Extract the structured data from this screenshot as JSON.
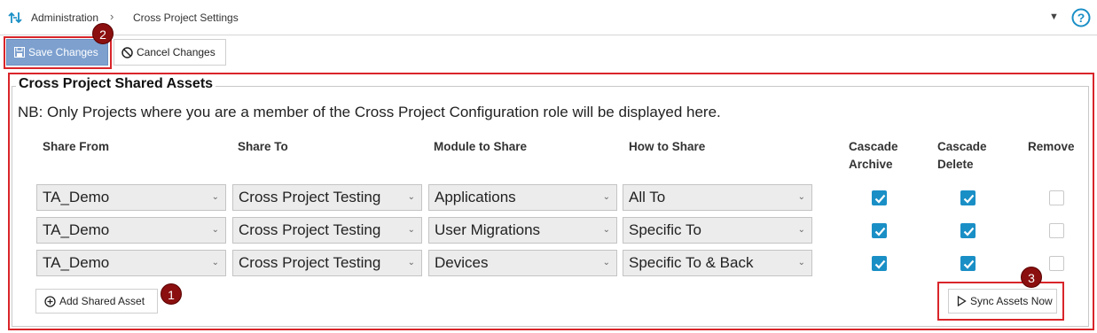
{
  "breadcrumb": {
    "root": "Administration",
    "current": "Cross Project Settings"
  },
  "toolbar": {
    "save_label": "Save Changes",
    "cancel_label": "Cancel Changes"
  },
  "panel": {
    "title": "Cross Project Shared Assets",
    "note": "NB: Only Projects where you are a member of the Cross Project Configuration role will be displayed here."
  },
  "columns": {
    "share_from": "Share From",
    "share_to": "Share To",
    "module": "Module to Share",
    "how": "How to Share",
    "cascade_archive_1": "Cascade",
    "cascade_archive_2": "Archive",
    "cascade_delete_1": "Cascade",
    "cascade_delete_2": "Delete",
    "remove": "Remove"
  },
  "rows": [
    {
      "share_from": "TA_Demo",
      "share_to": "Cross Project Testing",
      "module": "Applications",
      "how": "All To",
      "cascade_archive": true,
      "cascade_delete": true,
      "remove": false
    },
    {
      "share_from": "TA_Demo",
      "share_to": "Cross Project Testing",
      "module": "User Migrations",
      "how": "Specific To",
      "cascade_archive": true,
      "cascade_delete": true,
      "remove": false
    },
    {
      "share_from": "TA_Demo",
      "share_to": "Cross Project Testing",
      "module": "Devices",
      "how": "Specific To & Back",
      "cascade_archive": true,
      "cascade_delete": true,
      "remove": false
    }
  ],
  "actions": {
    "add_label": "Add Shared Asset",
    "sync_label": "Sync Assets Now"
  },
  "callouts": [
    "1",
    "2",
    "3"
  ],
  "colors": {
    "accent": "#1a8fc6",
    "save_button": "#7da0cf",
    "highlight": "#d9252a",
    "callout": "#8b0f0f"
  },
  "icons": {
    "nav": "swap-arrows-icon",
    "help": "help-circle-icon",
    "save": "floppy-disk-icon",
    "cancel": "prohibited-icon",
    "add": "plus-circle-icon",
    "sync": "play-triangle-icon"
  }
}
